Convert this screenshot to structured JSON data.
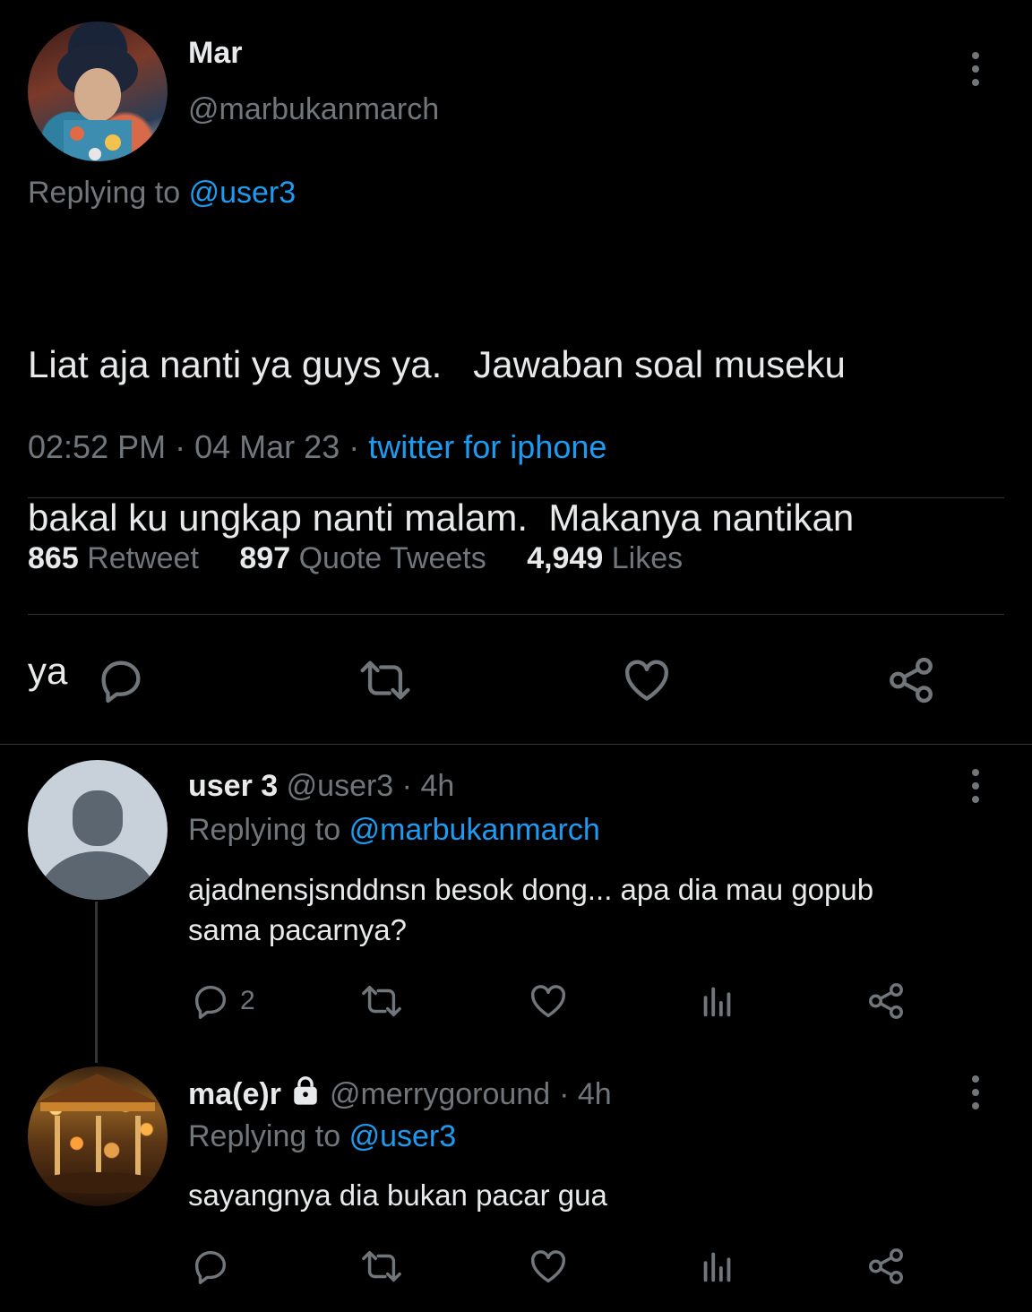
{
  "main_tweet": {
    "display_name": "Mar",
    "handle": "@marbukanmarch",
    "replying_prefix": "Replying to",
    "replying_to": "@user3",
    "text_line1": "Liat aja nanti ya guys ya.   Jawaban soal museku",
    "text_line2": "bakal ku ungkap nanti malam.  Makanya nantikan",
    "text_line3": "ya",
    "time": "02:52 PM",
    "date": "04 Mar 23",
    "source": "twitter for iphone",
    "separator": "·",
    "stats": {
      "retweets_count": "865",
      "retweets_label": "Retweet",
      "quotes_count": "897",
      "quotes_label": "Quote Tweets",
      "likes_count": "4,949",
      "likes_label": "Likes"
    }
  },
  "replies": [
    {
      "display_name": "user 3",
      "handle": "@user3",
      "time": "· 4h",
      "replying_prefix": "Replying to",
      "replying_to": "@marbukanmarch",
      "text_line1": "ajadnensjsnddnsn besok dong... apa dia mau gopub",
      "text_line2": "sama pacarnya?",
      "reply_count": "2"
    },
    {
      "display_name": "ma(e)r",
      "handle": "@merrygoround",
      "time": "· 4h",
      "replying_prefix": "Replying to",
      "replying_to": "@user3",
      "text_line1": "sayangnya dia bukan pacar gua",
      "reply_count": ""
    }
  ],
  "colors": {
    "background": "#000000",
    "text": "#e7e9ea",
    "muted": "#71767b",
    "link": "#1d9bf0",
    "divider": "#2f3336"
  },
  "icons": [
    "more-vertical-icon",
    "reply-icon",
    "retweet-icon",
    "like-icon",
    "share-icon",
    "views-icon",
    "lock-icon"
  ]
}
